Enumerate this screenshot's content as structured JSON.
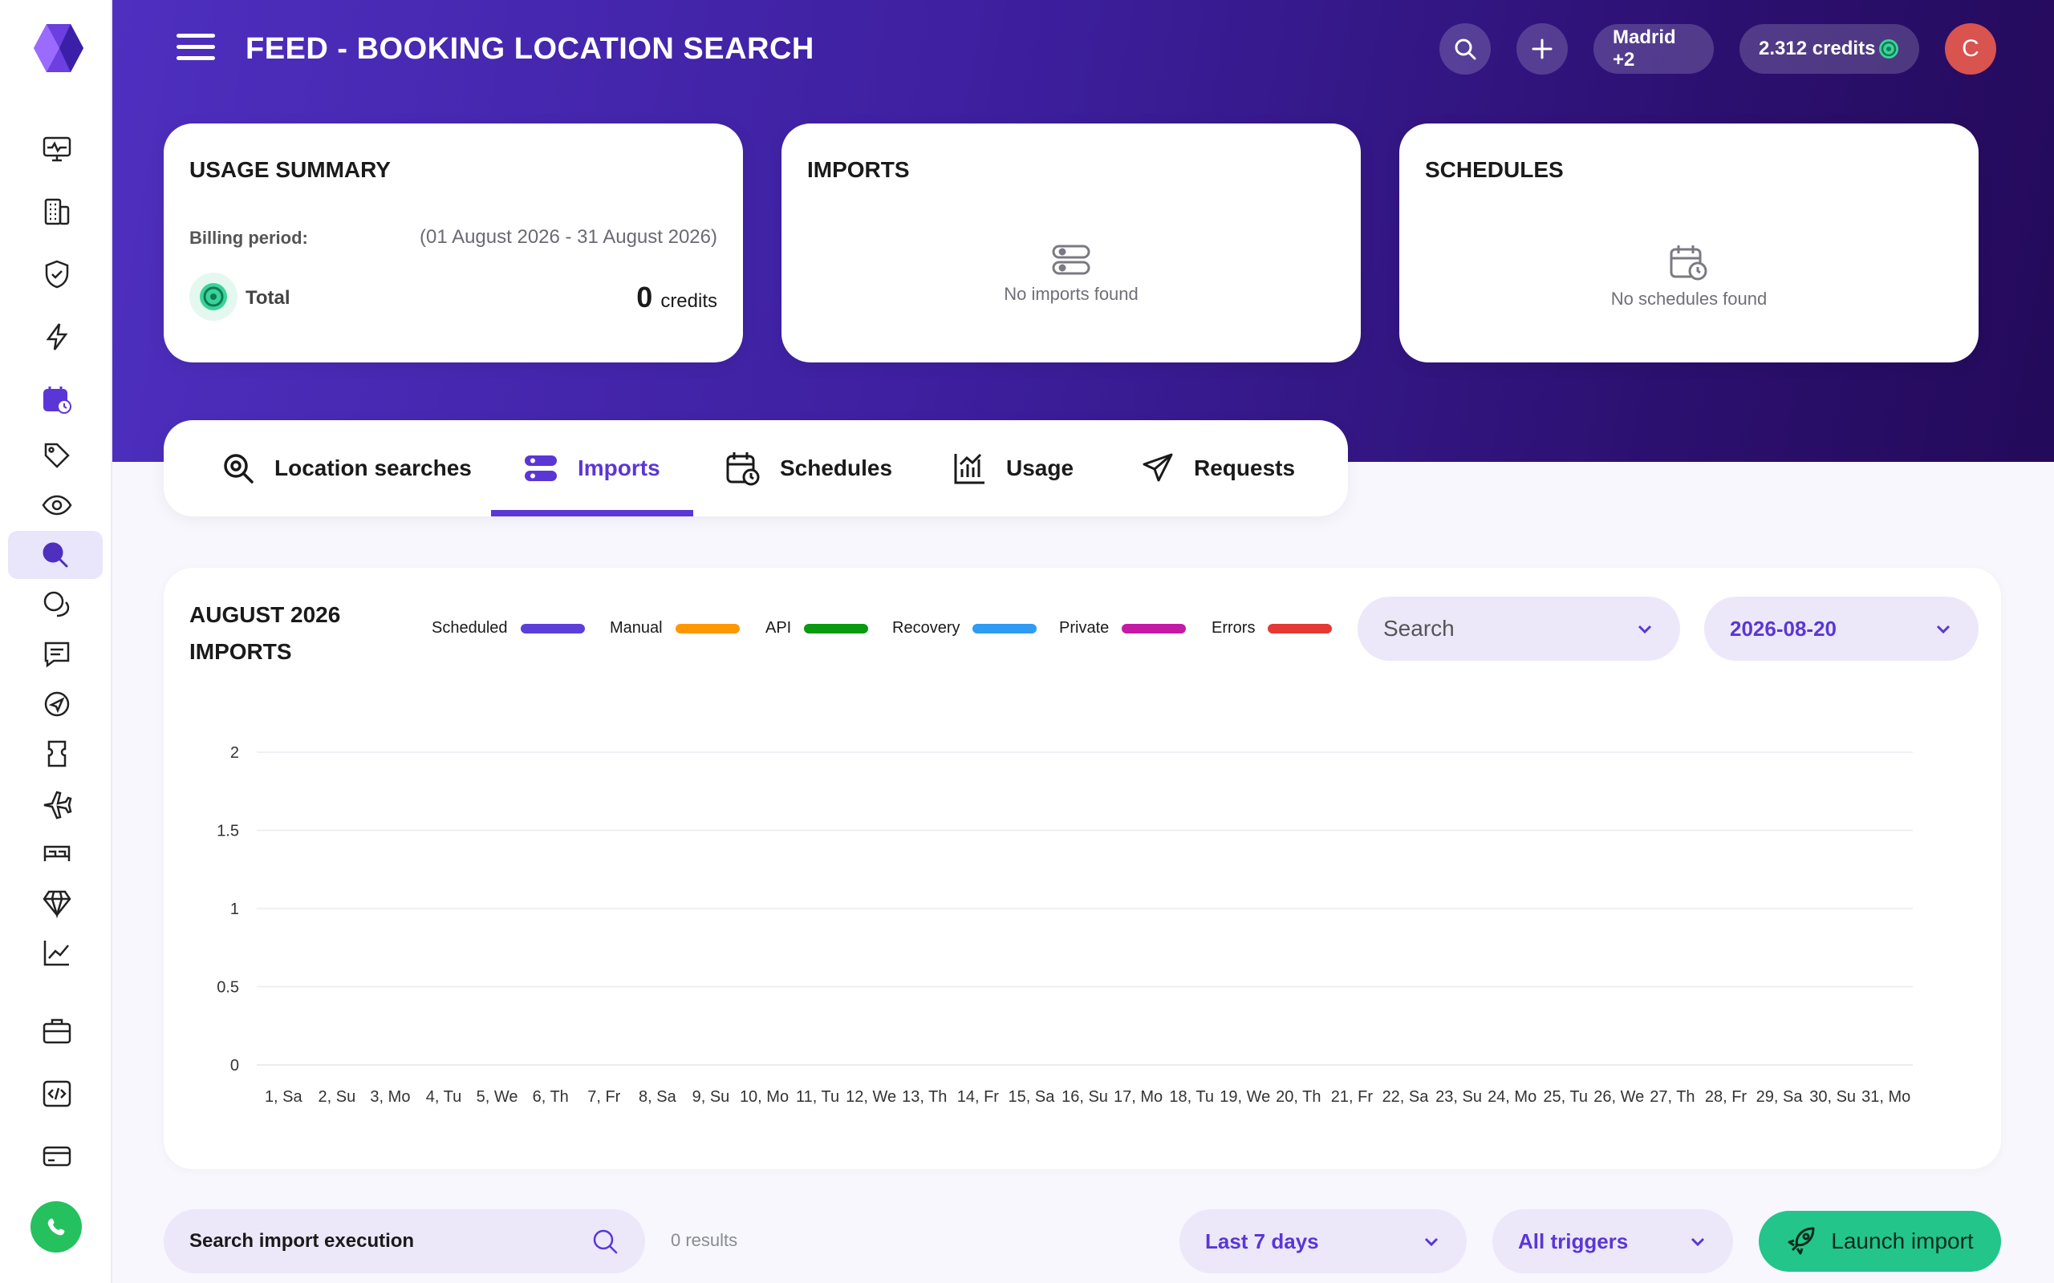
{
  "header": {
    "title": "FEED - BOOKING LOCATION SEARCH",
    "location_pill": "Madrid +2",
    "credits_pill": "2.312 credits",
    "avatar_initial": "C"
  },
  "cards": {
    "usage": {
      "title": "USAGE SUMMARY",
      "billing_label": "Billing period:",
      "billing_value": "(01 August 2026 - 31 August 2026)",
      "total_label": "Total",
      "total_value": "0",
      "total_unit": "credits"
    },
    "imports": {
      "title": "IMPORTS",
      "empty": "No imports found"
    },
    "schedules": {
      "title": "SCHEDULES",
      "empty": "No schedules found"
    }
  },
  "tabs": [
    {
      "label": "Location searches",
      "icon": "location-search-icon",
      "active": false
    },
    {
      "label": "Imports",
      "icon": "imports-icon",
      "active": true
    },
    {
      "label": "Schedules",
      "icon": "schedules-icon",
      "active": false
    },
    {
      "label": "Usage",
      "icon": "usage-chart-icon",
      "active": false
    },
    {
      "label": "Requests",
      "icon": "paper-plane-icon",
      "active": false
    }
  ],
  "chart": {
    "title": "AUGUST 2026 IMPORTS",
    "search_dropdown": "Search",
    "date_dropdown": "2026-08-20"
  },
  "chart_data": {
    "type": "line",
    "title": "AUGUST 2026 IMPORTS",
    "x": [
      "1, Sa",
      "2, Su",
      "3, Mo",
      "4, Tu",
      "5, We",
      "6, Th",
      "7, Fr",
      "8, Sa",
      "9, Su",
      "10, Mo",
      "11, Tu",
      "12, We",
      "13, Th",
      "14, Fr",
      "15, Sa",
      "16, Su",
      "17, Mo",
      "18, Tu",
      "19, We",
      "20, Th",
      "21, Fr",
      "22, Sa",
      "23, Su",
      "24, Mo",
      "25, Tu",
      "26, We",
      "27, Th",
      "28, Fr",
      "29, Sa",
      "30, Su",
      "31, Mo"
    ],
    "yticks": [
      "0",
      "0.5",
      "1",
      "1.5",
      "2"
    ],
    "ylim": [
      0,
      2
    ],
    "grid": true,
    "legend_position": "top",
    "series": [
      {
        "name": "Scheduled",
        "color": "#5b3fd8",
        "values": [
          0,
          0,
          0,
          0,
          0,
          0,
          0,
          0,
          0,
          0,
          0,
          0,
          0,
          0,
          0,
          0,
          0,
          0,
          0,
          0,
          0,
          0,
          0,
          0,
          0,
          0,
          0,
          0,
          0,
          0,
          0
        ]
      },
      {
        "name": "Manual",
        "color": "#ff9800",
        "values": [
          0,
          0,
          0,
          0,
          0,
          0,
          0,
          0,
          0,
          0,
          0,
          0,
          0,
          0,
          0,
          0,
          0,
          0,
          0,
          0,
          0,
          0,
          0,
          0,
          0,
          0,
          0,
          0,
          0,
          0,
          0
        ]
      },
      {
        "name": "API",
        "color": "#0a9a12",
        "values": [
          0,
          0,
          0,
          0,
          0,
          0,
          0,
          0,
          0,
          0,
          0,
          0,
          0,
          0,
          0,
          0,
          0,
          0,
          0,
          0,
          0,
          0,
          0,
          0,
          0,
          0,
          0,
          0,
          0,
          0,
          0
        ]
      },
      {
        "name": "Recovery",
        "color": "#2f9bf2",
        "values": [
          0,
          0,
          0,
          0,
          0,
          0,
          0,
          0,
          0,
          0,
          0,
          0,
          0,
          0,
          0,
          0,
          0,
          0,
          0,
          0,
          0,
          0,
          0,
          0,
          0,
          0,
          0,
          0,
          0,
          0,
          0
        ]
      },
      {
        "name": "Private",
        "color": "#c41aa6",
        "values": [
          0,
          0,
          0,
          0,
          0,
          0,
          0,
          0,
          0,
          0,
          0,
          0,
          0,
          0,
          0,
          0,
          0,
          0,
          0,
          0,
          0,
          0,
          0,
          0,
          0,
          0,
          0,
          0,
          0,
          0,
          0
        ]
      },
      {
        "name": "Errors",
        "color": "#e53935",
        "values": [
          0,
          0,
          0,
          0,
          0,
          0,
          0,
          0,
          0,
          0,
          0,
          0,
          0,
          0,
          0,
          0,
          0,
          0,
          0,
          0,
          0,
          0,
          0,
          0,
          0,
          0,
          0,
          0,
          0,
          0,
          0
        ]
      }
    ]
  },
  "bottom": {
    "search_placeholder": "Search import execution",
    "results": "0 results",
    "period_dropdown": "Last 7 days",
    "trigger_dropdown": "All triggers",
    "launch_button": "Launch import"
  },
  "colors": {
    "accent": "#5b36d6",
    "launch": "#23c58a"
  }
}
